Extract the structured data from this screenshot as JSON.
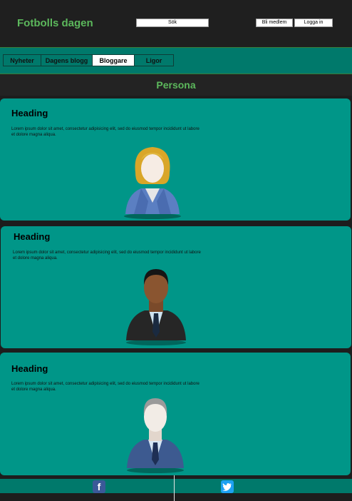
{
  "header": {
    "site_title": "Fotbolls dagen",
    "search_label": "Sök",
    "member_button": "Bli medlem",
    "login_button": "Logga in"
  },
  "nav": {
    "tabs": [
      {
        "label": "Nyheter"
      },
      {
        "label": "Dagens blogg"
      },
      {
        "label": "Bloggare",
        "active": true
      },
      {
        "label": "Ligor"
      }
    ]
  },
  "section": {
    "title": "Persona"
  },
  "personas": [
    {
      "heading": "Heading",
      "text": "Lorem ipsum dolor sit amet, consectetur adipisicing elit, sed do eiusmod tempor incididunt ut labore et dolore magna aliqua.",
      "avatar": "businesswoman-icon"
    },
    {
      "heading": "Heading",
      "text": "Lorem ipsum dolor sit amet, consectetur adipisicing elit, sed do eiusmod tempor incididunt ut labore et dolore magna aliqua.",
      "avatar": "businessman-dark-icon"
    },
    {
      "heading": "Heading",
      "text": "Lorem ipsum dolor sit amet, consectetur adipisicing elit, sed do eiusmod tempor incididunt ut labore et dolore magna aliqua.",
      "avatar": "businessman-grey-icon"
    }
  ],
  "footer": {
    "icons": [
      "facebook-icon",
      "twitter-icon"
    ]
  }
}
